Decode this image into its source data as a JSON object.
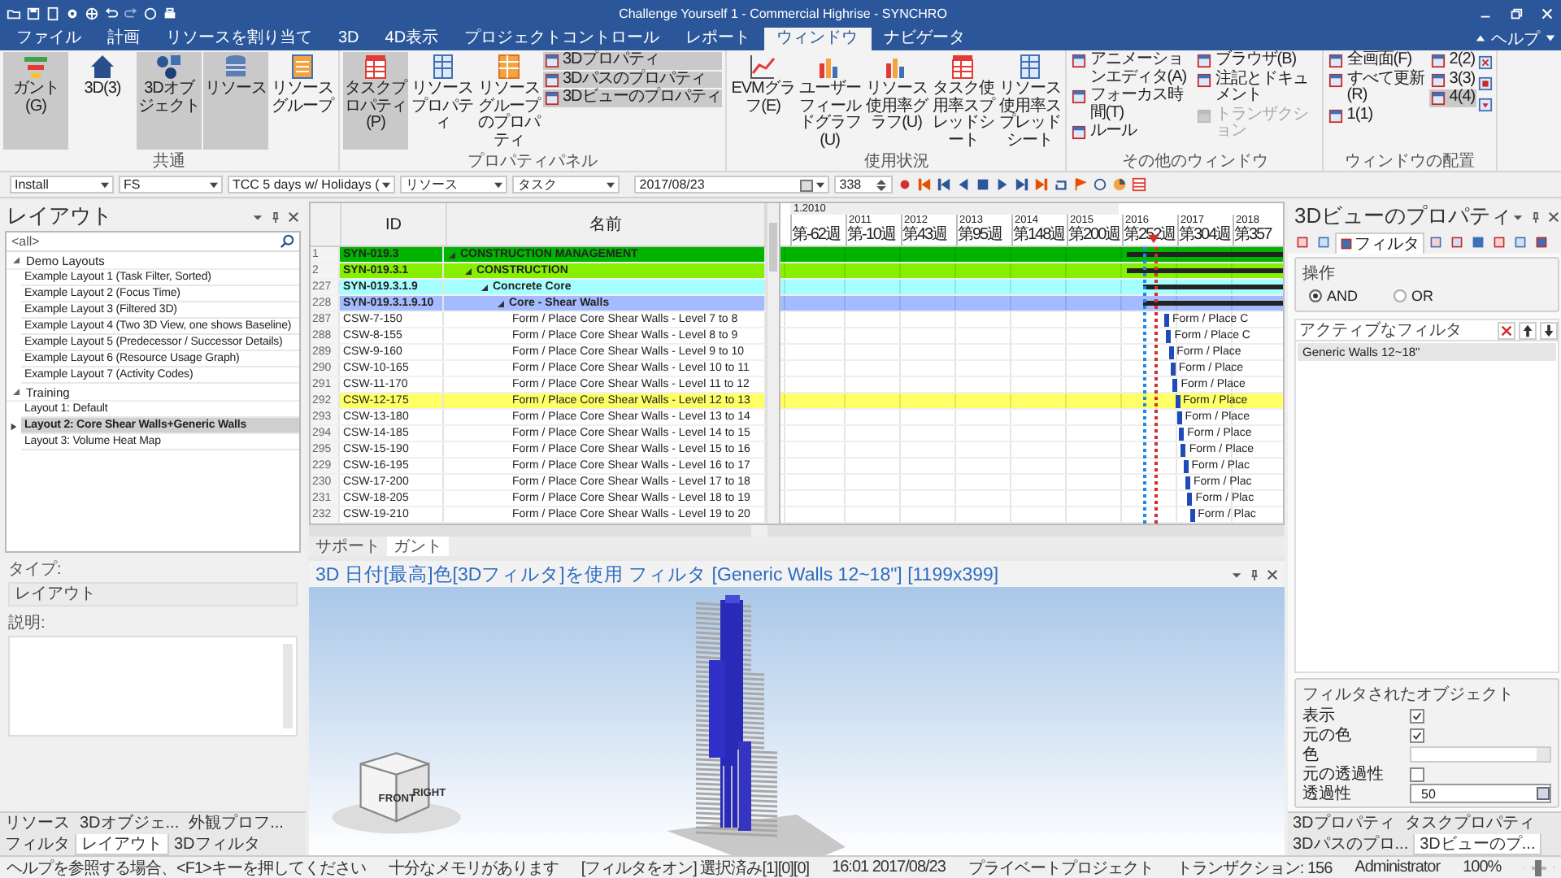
{
  "window": {
    "title": "Challenge Yourself 1 - Commercial Highrise - SYNCHRO"
  },
  "menu_tabs": [
    {
      "label": "ファイル",
      "selected": false
    },
    {
      "label": "計画",
      "selected": false
    },
    {
      "label": "リソースを割り当て",
      "selected": false
    },
    {
      "label": "3D",
      "selected": false
    },
    {
      "label": "4D表示",
      "selected": false
    },
    {
      "label": "プロジェクトコントロール",
      "selected": false
    },
    {
      "label": "レポート",
      "selected": false
    },
    {
      "label": "ウィンドウ",
      "selected": true
    },
    {
      "label": "ナビゲータ",
      "selected": false
    }
  ],
  "help": "ヘルプ",
  "ribbon": [
    {
      "label": "共通",
      "items": [
        {
          "kind": "large",
          "label": "ガント(G)",
          "selected": true
        },
        {
          "kind": "large",
          "label": "3D(3)",
          "selected": false
        },
        {
          "kind": "large",
          "label": "3Dオブジェクト",
          "selected": true
        },
        {
          "kind": "large",
          "label": "リソース",
          "selected": true
        },
        {
          "kind": "large",
          "label": "リソースグループ",
          "selected": false
        }
      ]
    },
    {
      "label": "プロパティパネル",
      "items": [
        {
          "kind": "large",
          "label": "タスクプロパティ(P)",
          "selected": true
        },
        {
          "kind": "large",
          "label": "リソースプロパティ",
          "selected": false
        },
        {
          "kind": "large",
          "label": "リソースグループのプロパティ",
          "selected": false
        },
        {
          "kind": "small",
          "label": "3Dプロパティ",
          "selected": true
        },
        {
          "kind": "small",
          "label": "3Dパスのプロパティ",
          "selected": true
        },
        {
          "kind": "small",
          "label": "3Dビューのプロパティ",
          "selected": true
        }
      ]
    },
    {
      "label": "使用状況",
      "items": [
        {
          "kind": "large",
          "label": "EVMグラフ(E)",
          "selected": false
        },
        {
          "kind": "large",
          "label": "ユーザーフィールドグラフ(U)",
          "selected": false
        },
        {
          "kind": "large",
          "label": "リソース使用率グラフ(U)",
          "selected": false
        },
        {
          "kind": "large",
          "label": "タスク使用率スプレッドシート",
          "selected": false
        },
        {
          "kind": "large",
          "label": "リソース使用率スプレッドシート",
          "selected": false
        }
      ]
    },
    {
      "label": "その他のウィンドウ",
      "items": [
        {
          "kind": "small",
          "label": "アニメーションエディタ(A)",
          "selected": false,
          "disabled": false
        },
        {
          "kind": "small",
          "label": "フォーカス時間(T)",
          "selected": false,
          "disabled": false
        },
        {
          "kind": "small",
          "label": "ルール",
          "selected": false,
          "disabled": false
        },
        {
          "kind": "small",
          "label": "ブラウザ(B)",
          "selected": false,
          "disabled": false
        },
        {
          "kind": "small",
          "label": "注記とドキュメント",
          "selected": false,
          "disabled": false
        },
        {
          "kind": "small",
          "label": "トランザクション",
          "selected": false,
          "disabled": true
        }
      ]
    },
    {
      "label": "ウィンドウの配置",
      "items": [
        {
          "kind": "small",
          "label": "全画面(F)",
          "selected": false
        },
        {
          "kind": "small",
          "label": "すべて更新(R)",
          "selected": false
        },
        {
          "kind": "small",
          "label": "1(1)",
          "selected": false
        },
        {
          "kind": "small",
          "label": "2(2)",
          "selected": false
        },
        {
          "kind": "small",
          "label": "3(3)",
          "selected": false
        },
        {
          "kind": "small",
          "label": "4(4)",
          "selected": true
        }
      ]
    }
  ],
  "toolbar": [
    {
      "kind": "combo",
      "value": "Install"
    },
    {
      "kind": "combo",
      "value": "FS"
    },
    {
      "kind": "combo",
      "value": "TCC 5 days w/ Holidays ("
    },
    {
      "kind": "combo",
      "value": "リソース"
    },
    {
      "kind": "combo",
      "value": "タスク"
    },
    {
      "kind": "date",
      "value": "2017/08/23"
    },
    {
      "kind": "spin",
      "value": "338"
    }
  ],
  "layout_panel": {
    "title": "レイアウト",
    "filter": "<all>",
    "tree": [
      {
        "label": "Demo Layouts",
        "expanded": true,
        "selected": false,
        "children": [
          {
            "label": "Example Layout 1 (Task Filter, Sorted)",
            "selected": false
          },
          {
            "label": "Example Layout 2 (Focus Time)",
            "selected": false
          },
          {
            "label": "Example Layout 3 (Filtered 3D)",
            "selected": false
          },
          {
            "label": "Example Layout 4 (Two 3D View, one shows Baseline)",
            "selected": false
          },
          {
            "label": "Example Layout 5 (Predecessor / Successor Details)",
            "selected": false
          },
          {
            "label": "Example Layout 6 (Resource Usage Graph)",
            "selected": false
          },
          {
            "label": "Example Layout 7 (Activity Codes)",
            "selected": false
          }
        ]
      },
      {
        "label": "Training",
        "expanded": true,
        "selected": false,
        "children": [
          {
            "label": "Layout 1: Default",
            "selected": false
          },
          {
            "label": "Layout 2: Core Shear Walls+Generic Walls",
            "selected": true
          },
          {
            "label": "Layout 3: Volume Heat Map",
            "selected": false
          }
        ]
      }
    ],
    "type_label": "タイプ:",
    "type_value": "レイアウト",
    "description_label": "説明:"
  },
  "left_tabs": [
    {
      "label": "リソース",
      "selected": false
    },
    {
      "label": "3Dオブジェ...",
      "selected": false
    },
    {
      "label": "外観プロフ...",
      "selected": false
    },
    {
      "label": "フィルタ",
      "selected": false
    },
    {
      "label": "レイアウト",
      "selected": true
    },
    {
      "label": "3Dフィルタ",
      "selected": false
    }
  ],
  "schedule": {
    "columns": [
      "ID",
      "名前"
    ],
    "rows": [
      {
        "num": "1",
        "id": "SYN-019.3",
        "name": "CONSTRUCTION MANAGEMENT",
        "color": "#00b400",
        "selected": false,
        "children": [
          {
            "num": "2",
            "id": "SYN-019.3.1",
            "name": "CONSTRUCTION",
            "color": "#86f000",
            "selected": false,
            "children": [
              {
                "num": "227",
                "id": "SYN-019.3.1.9",
                "name": "Concrete Core",
                "color": "#a6ffff",
                "selected": false,
                "children": [
                  {
                    "num": "228",
                    "id": "SYN-019.3.1.9.10",
                    "name": "Core - Shear Walls",
                    "color": "#a4bcff",
                    "selected": false,
                    "children": [
                      {
                        "num": "287",
                        "id": "CSW-7-150",
                        "name": "Form / Place Core Shear Walls - Level 7 to 8",
                        "bar_label": "Form / Place C",
                        "selected": false
                      },
                      {
                        "num": "288",
                        "id": "CSW-8-155",
                        "name": "Form / Place Core Shear Walls - Level 8 to 9",
                        "bar_label": "Form / Place C",
                        "selected": false
                      },
                      {
                        "num": "289",
                        "id": "CSW-9-160",
                        "name": "Form / Place Core Shear Walls - Level 9 to 10",
                        "bar_label": "Form / Place",
                        "selected": false
                      },
                      {
                        "num": "290",
                        "id": "CSW-10-165",
                        "name": "Form / Place Core Shear Walls - Level 10 to 11",
                        "bar_label": "Form / Place",
                        "selected": false
                      },
                      {
                        "num": "291",
                        "id": "CSW-11-170",
                        "name": "Form / Place Core Shear Walls - Level 11 to 12",
                        "bar_label": "Form / Place",
                        "selected": false
                      },
                      {
                        "num": "292",
                        "id": "CSW-12-175",
                        "name": "Form / Place Core Shear Walls - Level 12 to 13",
                        "bar_label": "Form / Place",
                        "selected": true
                      },
                      {
                        "num": "293",
                        "id": "CSW-13-180",
                        "name": "Form / Place Core Shear Walls - Level 13 to 14",
                        "bar_label": "Form / Place",
                        "selected": false
                      },
                      {
                        "num": "294",
                        "id": "CSW-14-185",
                        "name": "Form / Place Core Shear Walls - Level 14 to 15",
                        "bar_label": "Form / Place",
                        "selected": false
                      },
                      {
                        "num": "295",
                        "id": "CSW-15-190",
                        "name": "Form / Place Core Shear Walls - Level 15 to 16",
                        "bar_label": "Form / Place",
                        "selected": false
                      },
                      {
                        "num": "229",
                        "id": "CSW-16-195",
                        "name": "Form / Place Core Shear Walls - Level 16 to 17",
                        "bar_label": "Form / Plac",
                        "selected": false
                      },
                      {
                        "num": "230",
                        "id": "CSW-17-200",
                        "name": "Form / Place Core Shear Walls - Level 17 to 18",
                        "bar_label": "Form / Plac",
                        "selected": false
                      },
                      {
                        "num": "231",
                        "id": "CSW-18-205",
                        "name": "Form / Place Core Shear Walls - Level 18 to 19",
                        "bar_label": "Form / Plac",
                        "selected": false
                      },
                      {
                        "num": "232",
                        "id": "CSW-19-210",
                        "name": "Form / Place Core Shear Walls - Level 19 to 20",
                        "bar_label": "Form / Plac",
                        "selected": false
                      }
                    ]
                  }
                ]
              }
            ]
          }
        ]
      }
    ],
    "tabs": [
      {
        "label": "サポート",
        "selected": false
      },
      {
        "label": "ガント",
        "selected": true
      }
    ]
  },
  "gantt": {
    "top_label": "1.2010",
    "years": [
      "2011",
      "2012",
      "2013",
      "2014",
      "2015",
      "2016",
      "2017",
      "2018"
    ],
    "weeks": [
      "第-62週",
      "第-10週",
      "第43週",
      "第95週",
      "第148週",
      "第200週",
      "第252週",
      "第304週",
      "第357"
    ]
  },
  "view3d": {
    "title": "3D 日付[最高]色[3Dフィルタ]を使用 フィルタ [Generic Walls 12~18\"]  [1199x399]",
    "cube_labels": [
      "FRONT",
      "RIGHT"
    ]
  },
  "view_props": {
    "title": "3Dビューのプロパティ",
    "tabs": [
      {
        "selected": false
      },
      {
        "selected": false
      },
      {
        "label": "フィルタ",
        "selected": true
      },
      {
        "selected": false
      },
      {
        "selected": false
      },
      {
        "selected": false
      },
      {
        "selected": false
      },
      {
        "selected": false
      },
      {
        "selected": false
      }
    ],
    "operation": {
      "label": "操作",
      "options": [
        {
          "label": "AND",
          "selected": true
        },
        {
          "label": "OR",
          "selected": false
        }
      ]
    },
    "active_filters": {
      "label": "アクティブなフィルタ",
      "items": [
        {
          "label": "Generic Walls 12~18\"",
          "selected": true
        }
      ]
    },
    "filtered_objects": {
      "label": "フィルタされたオブジェクト",
      "rows": [
        {
          "kind": "check",
          "label": "表示",
          "checked": true
        },
        {
          "kind": "check",
          "label": "元の色",
          "checked": true
        },
        {
          "kind": "color",
          "label": "色"
        },
        {
          "kind": "check",
          "label": "元の透過性",
          "checked": false
        },
        {
          "kind": "spin",
          "label": "透過性",
          "value": "50"
        }
      ]
    }
  },
  "right_tabs": [
    {
      "label": "3Dプロパティ",
      "selected": false
    },
    {
      "label": "タスクプロパティ",
      "selected": false
    },
    {
      "label": "3Dパスのプロ...",
      "selected": false
    },
    {
      "label": "3Dビューのプ...",
      "selected": true
    }
  ],
  "status_bar": {
    "help": "ヘルプを参照する場合、<F1>キーを押してください",
    "items": [
      "十分なメモリがあります",
      "[フィルタをオン] 選択済み[1][0][0]",
      "16:01 2017/08/23",
      "プライベートプロジェクト",
      "トランザクション: 156",
      "Administrator"
    ],
    "zoom": "100%",
    "zoom_slider": {
      "level": 0.45
    }
  }
}
